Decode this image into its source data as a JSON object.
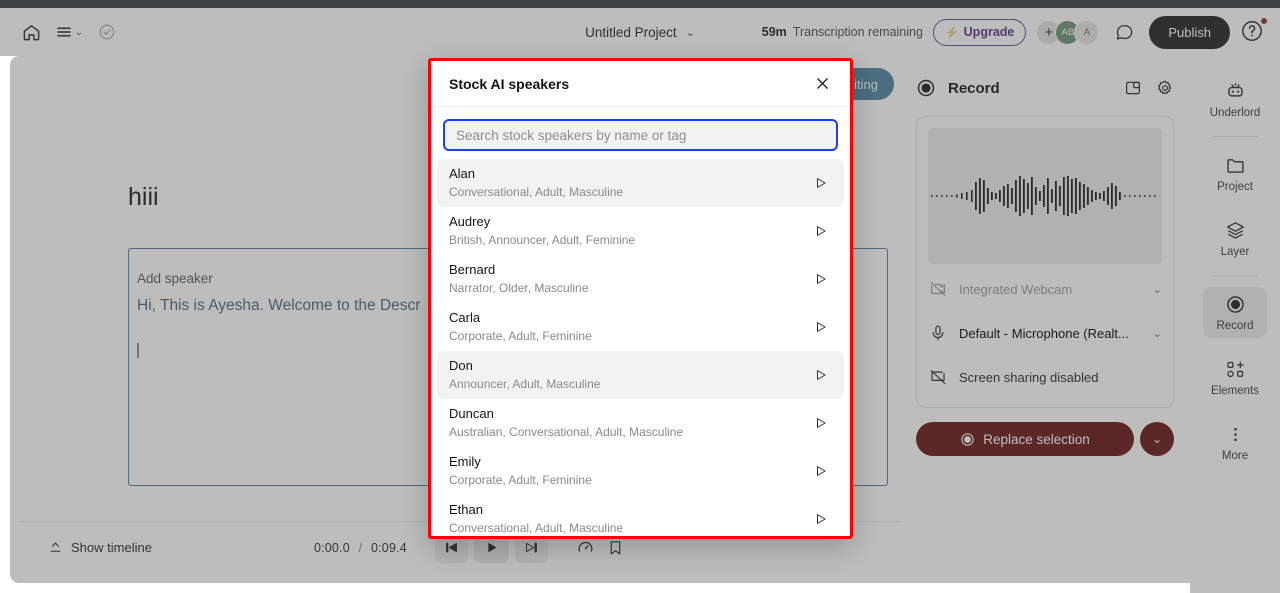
{
  "topbar": {
    "home_icon": "home-icon",
    "menu_icon": "hamburger-menu-icon",
    "check_icon": "check-circle-icon",
    "project_title": "Untitled Project",
    "project_chevron": "⌄",
    "transcription_minutes": "59m",
    "transcription_label": "Transcription remaining",
    "upgrade_label": "Upgrade",
    "upgrade_icon": "lightning-bolt-icon",
    "upgrade_color": "#6d28d9",
    "avatar_plus": "+",
    "avatar_ab": "AB",
    "avatar_a": "A",
    "comment_icon": "comment-bubble-icon",
    "publish_label": "Publish",
    "help_icon": "help-circle-icon",
    "notification_color": "#e11d1d"
  },
  "editor": {
    "blue_button_label": "iting",
    "doc_title": "hiii",
    "add_speaker_label": "Add speaker",
    "transcript_text": "Hi, This is Ayesha. Welcome to the Descr",
    "block_border_color": "#2f86c5"
  },
  "bottombar": {
    "show_timeline_label": "Show timeline",
    "timeline_icon": "timeline-toggle-icon",
    "current_time": "0:00.0",
    "time_separator": "/",
    "total_time": "0:09.4",
    "skip_back_icon": "skip-to-start-icon",
    "play_icon": "play-icon",
    "skip_forward_icon": "skip-to-end-icon",
    "speed_icon": "playback-speed-icon",
    "bookmark_icon": "bookmark-icon"
  },
  "record_panel": {
    "record_dot_icon": "record-circle-icon",
    "title": "Record",
    "popout_icon": "pop-out-window-icon",
    "settings_icon": "gear-icon",
    "waveform_icon": "audio-waveform",
    "camera_icon": "camera-off-icon",
    "camera_label": "Integrated Webcam",
    "mic_icon": "microphone-icon",
    "mic_label": "Default - Microphone (Realt...",
    "screen_icon": "screen-share-off-icon",
    "screen_label": "Screen sharing disabled",
    "replace_label": "Replace selection",
    "replace_icon": "record-circle-icon",
    "replace_chevron": "⌄",
    "replace_color": "#b40000"
  },
  "rail": {
    "items": [
      {
        "label": "Underlord",
        "icon": "robot-icon",
        "active": false
      },
      {
        "label": "Project",
        "icon": "folder-icon",
        "active": false
      },
      {
        "label": "Layer",
        "icon": "layers-icon",
        "active": false
      },
      {
        "label": "Record",
        "icon": "record-circle-icon",
        "active": true
      },
      {
        "label": "Elements",
        "icon": "elements-add-icon",
        "active": false
      },
      {
        "label": "More",
        "icon": "more-vertical-icon",
        "active": false
      }
    ]
  },
  "modal": {
    "title": "Stock AI speakers",
    "close_icon": "close-x-icon",
    "search_placeholder": "Search stock speakers by name or tag",
    "search_value": "",
    "search_focus_color": "#1a42e8",
    "highlight_border_color": "#ff0000",
    "play_icon": "play-triangle-icon",
    "speakers": [
      {
        "name": "Alan",
        "tags": "Conversational, Adult, Masculine",
        "highlighted": true
      },
      {
        "name": "Audrey",
        "tags": "British, Announcer, Adult, Feminine",
        "highlighted": false
      },
      {
        "name": "Bernard",
        "tags": "Narrator, Older, Masculine",
        "highlighted": false
      },
      {
        "name": "Carla",
        "tags": "Corporate, Adult, Feminine",
        "highlighted": false
      },
      {
        "name": "Don",
        "tags": "Announcer, Adult, Masculine",
        "highlighted": true
      },
      {
        "name": "Duncan",
        "tags": "Australian, Conversational, Adult, Masculine",
        "highlighted": false
      },
      {
        "name": "Emily",
        "tags": "Corporate, Adult, Feminine",
        "highlighted": false
      },
      {
        "name": "Ethan",
        "tags": "Conversational, Adult, Masculine",
        "highlighted": false
      }
    ]
  }
}
